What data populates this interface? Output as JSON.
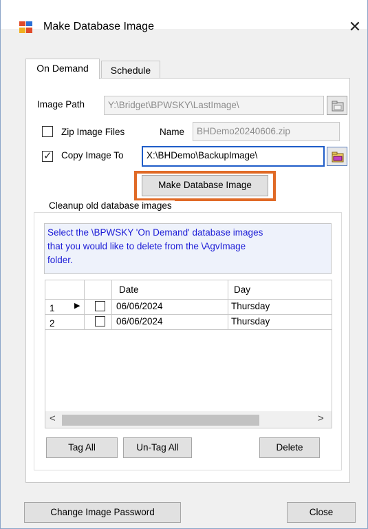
{
  "window": {
    "title": "Make Database Image",
    "close_label": "✕"
  },
  "tabs": [
    {
      "label": "On Demand",
      "active": true
    },
    {
      "label": "Schedule",
      "active": false
    }
  ],
  "form": {
    "image_path_label": "Image Path",
    "image_path_value": "Y:\\Bridget\\BPWSKY\\LastImage\\",
    "zip_label": "Zip Image Files",
    "zip_checked": false,
    "name_label": "Name",
    "name_value": "BHDemo20240606.zip",
    "copy_label": "Copy Image To",
    "copy_checked": true,
    "copy_value": "X:\\BHDemo\\BackupImage\\",
    "make_button": "Make Database Image"
  },
  "cleanup": {
    "group_title": "Cleanup old database images",
    "info_lines": [
      "Select the \\BPWSKY 'On Demand' database images",
      "that you would like to delete from the \\AgvImage",
      "folder."
    ],
    "columns": [
      "Date",
      "Day"
    ],
    "rows": [
      {
        "num": "1",
        "current": true,
        "checked": false,
        "date": "06/06/2024",
        "day": "Thursday"
      },
      {
        "num": "2",
        "current": false,
        "checked": false,
        "date": "06/06/2024",
        "day": "Thursday"
      }
    ],
    "scroll_left": "<",
    "scroll_right": ">",
    "tag_all": "Tag All",
    "untag_all": "Un-Tag All",
    "delete": "Delete"
  },
  "footer": {
    "change_password": "Change Image Password",
    "close": "Close"
  },
  "colors": {
    "highlight": "#e06a26",
    "info_text": "#1a1ad6",
    "focus_border": "#1e5cc8"
  },
  "icons": [
    "app-icon",
    "close-icon",
    "browse-folder-icon",
    "current-row-arrow-icon"
  ]
}
